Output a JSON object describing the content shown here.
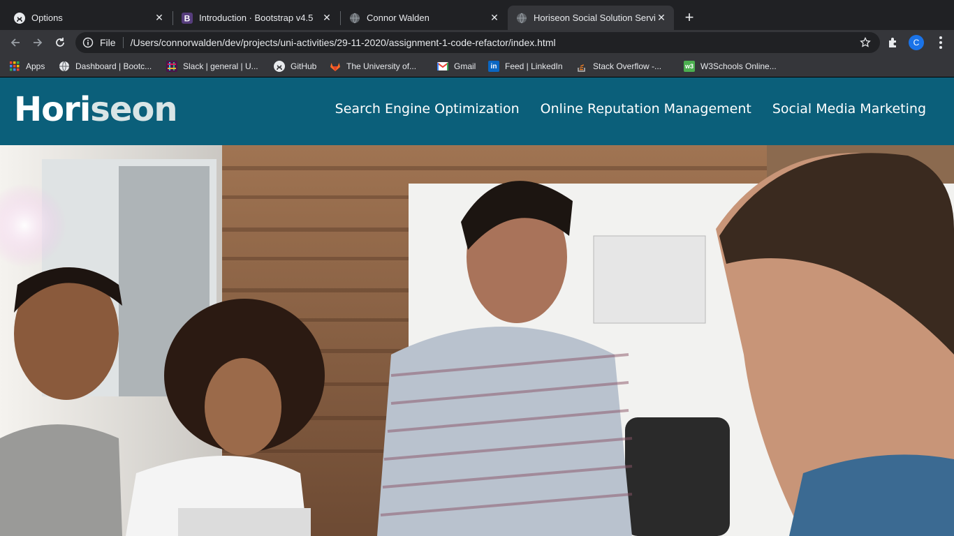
{
  "browser": {
    "tabs": [
      {
        "title": "Options",
        "icon": "github-icon"
      },
      {
        "title": "Introduction · Bootstrap v4.5",
        "icon": "bootstrap-icon"
      },
      {
        "title": "Connor Walden",
        "icon": "globe-icon"
      },
      {
        "title": "Horiseon Social Solution Servic",
        "icon": "globe-icon",
        "active": true
      }
    ],
    "address": {
      "scheme": "File",
      "url": "/Users/connorwalden/dev/projects/uni-activities/29-11-2020/assignment-1-code-refactor/index.html"
    },
    "profile_initial": "C",
    "bookmarks": [
      {
        "label": "Apps",
        "icon": "apps-grid-icon"
      },
      {
        "label": "Dashboard | Bootc...",
        "icon": "globe-icon"
      },
      {
        "label": "Slack | general | U...",
        "icon": "slack-icon"
      },
      {
        "label": "GitHub",
        "icon": "github-icon"
      },
      {
        "label": "The University of...",
        "icon": "gitlab-icon"
      },
      {
        "label": "Gmail",
        "icon": "gmail-icon"
      },
      {
        "label": "Feed | LinkedIn",
        "icon": "linkedin-icon"
      },
      {
        "label": "Stack Overflow -...",
        "icon": "stackoverflow-icon"
      },
      {
        "label": "W3Schools Online...",
        "icon": "w3schools-icon"
      }
    ]
  },
  "site": {
    "logo_main": "Hori",
    "logo_accent": "seon",
    "nav": [
      "Search Engine Optimization",
      "Online Reputation Management",
      "Social Media Marketing"
    ],
    "colors": {
      "header": "#0b5f7a",
      "logo_accent": "#d9e5e6"
    }
  }
}
